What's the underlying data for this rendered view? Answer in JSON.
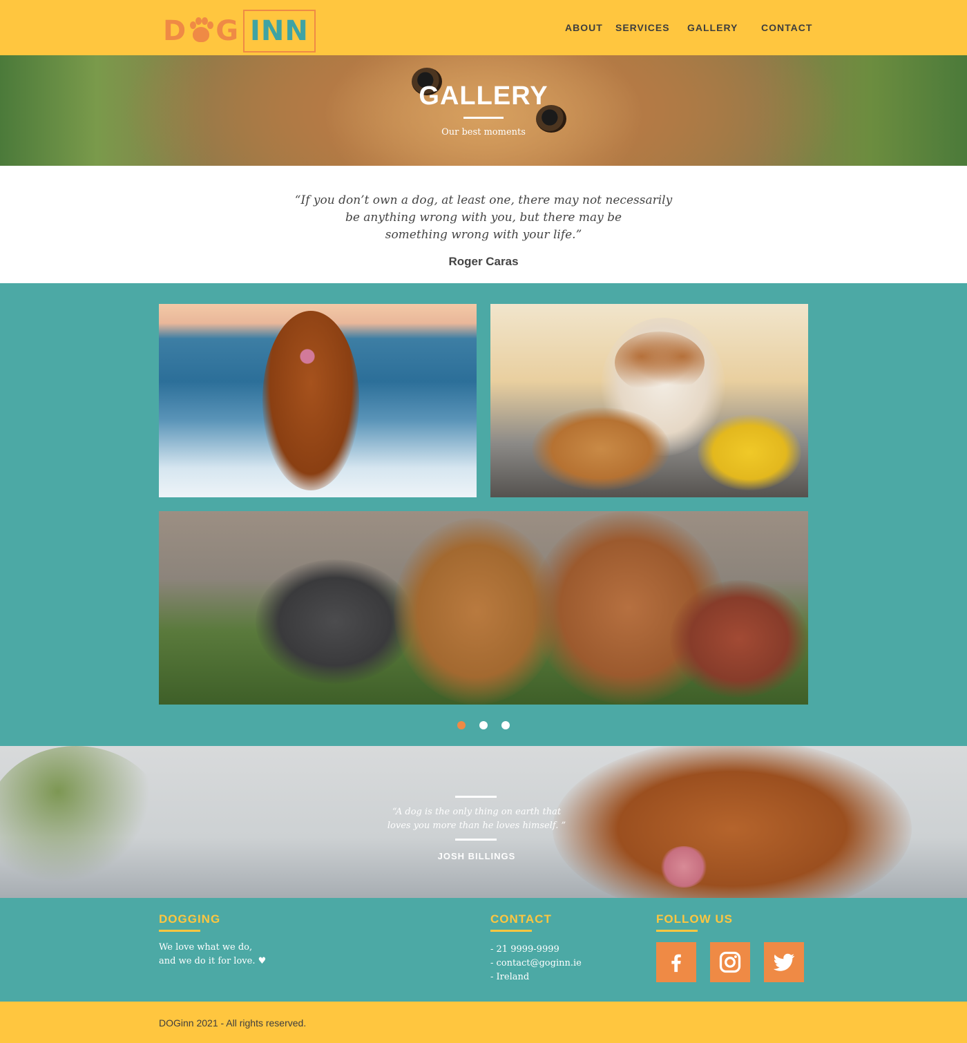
{
  "header": {
    "logo": {
      "part1": "D",
      "part1_end": "G",
      "part2": "INN"
    },
    "nav": [
      "ABOUT",
      "SERVICES",
      "GALLERY",
      "CONTACT"
    ]
  },
  "hero": {
    "title": "GALLERY",
    "subtitle": "Our best moments"
  },
  "quote": {
    "line1": "“If you don’t own a dog, at least one, there may not necessarily",
    "line2": "be anything wrong with you, but there may be",
    "line3": "something wrong with your life.”",
    "author": "Roger Caras"
  },
  "gallery": {
    "photos": [
      "dog-beach-photo",
      "puppy-toys-photo",
      "dogs-running-photo"
    ],
    "carousel": {
      "count": 3,
      "active": 1
    }
  },
  "banner_quote": {
    "line1": "“A dog is the only thing on earth that",
    "line2": "loves you more than he loves himself. ”",
    "author": "JOSH BILLINGS"
  },
  "footer": {
    "about": {
      "title": "DOGGING",
      "line1": "We love what we do,",
      "line2": "and we do it for love. ♥"
    },
    "contact": {
      "title": "CONTACT",
      "phone": "- 21 9999-9999",
      "email": "- contact@goginn.ie",
      "country": "- Ireland"
    },
    "follow": {
      "title": "FOLLOW US",
      "icons": [
        "facebook-icon",
        "instagram-icon",
        "twitter-icon"
      ]
    },
    "copyright": "DOGinn 2021 - All rights reserved."
  },
  "colors": {
    "yellow": "#ffc63f",
    "teal": "#4ca9a5",
    "orange": "#ef8a45",
    "logo_teal": "#3fa3a3"
  }
}
